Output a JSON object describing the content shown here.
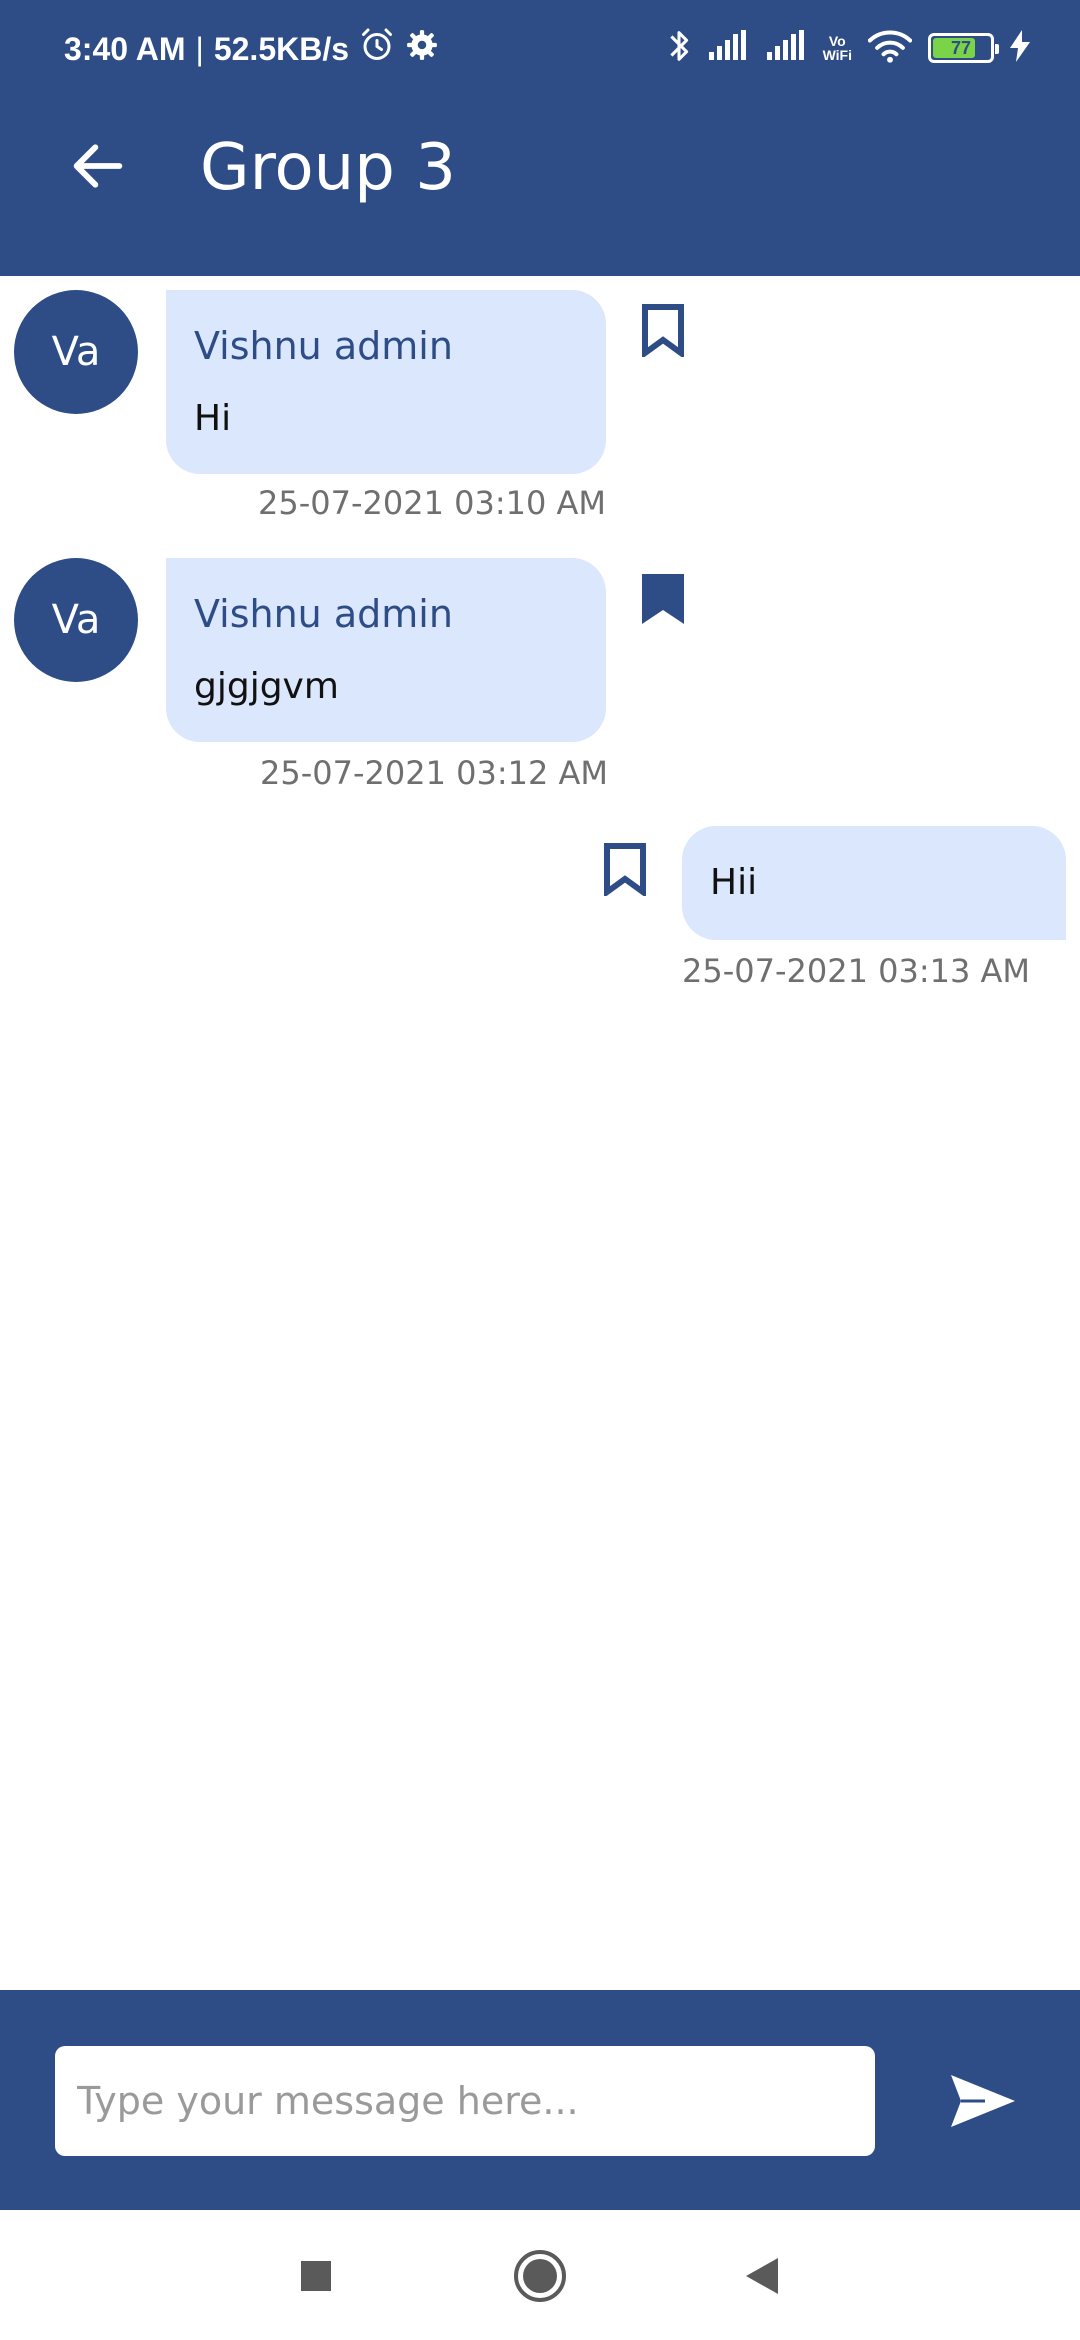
{
  "status_bar": {
    "time": "3:40 AM",
    "separator": "|",
    "network_speed": "52.5KB/s",
    "vowifi_top": "Vo",
    "vowifi_bottom": "WiFi",
    "battery_level": "77",
    "battery_fraction": 0.77,
    "icons": [
      "alarm-icon",
      "settings-icon",
      "bluetooth-icon",
      "signal-icon",
      "signal-icon",
      "wifi-icon",
      "battery-icon",
      "charging-icon"
    ]
  },
  "header": {
    "title": "Group 3",
    "back_icon": "arrow-left-icon"
  },
  "messages": [
    {
      "direction": "incoming",
      "avatar_initials": "Va",
      "sender": "Vishnu admin",
      "text": "Hi",
      "timestamp": "25-07-2021 03:10 AM",
      "bookmarked": false
    },
    {
      "direction": "incoming",
      "avatar_initials": "Va",
      "sender": "Vishnu admin",
      "text": "gjgjgvm",
      "timestamp": "25-07-2021 03:12 AM",
      "bookmarked": true
    },
    {
      "direction": "outgoing",
      "text": "Hii",
      "timestamp": "25-07-2021 03:13 AM",
      "bookmarked": false
    }
  ],
  "composer": {
    "placeholder": "Type your message here...",
    "value": "",
    "send_icon": "send-icon"
  },
  "nav_bar": {
    "buttons": [
      "recents-square-icon",
      "home-circle-icon",
      "back-triangle-icon"
    ]
  },
  "colors": {
    "primary": "#2e4d86",
    "bubble": "#dbe7fd",
    "timestamp": "#6f6f6f",
    "battery": "#7bd34a"
  }
}
